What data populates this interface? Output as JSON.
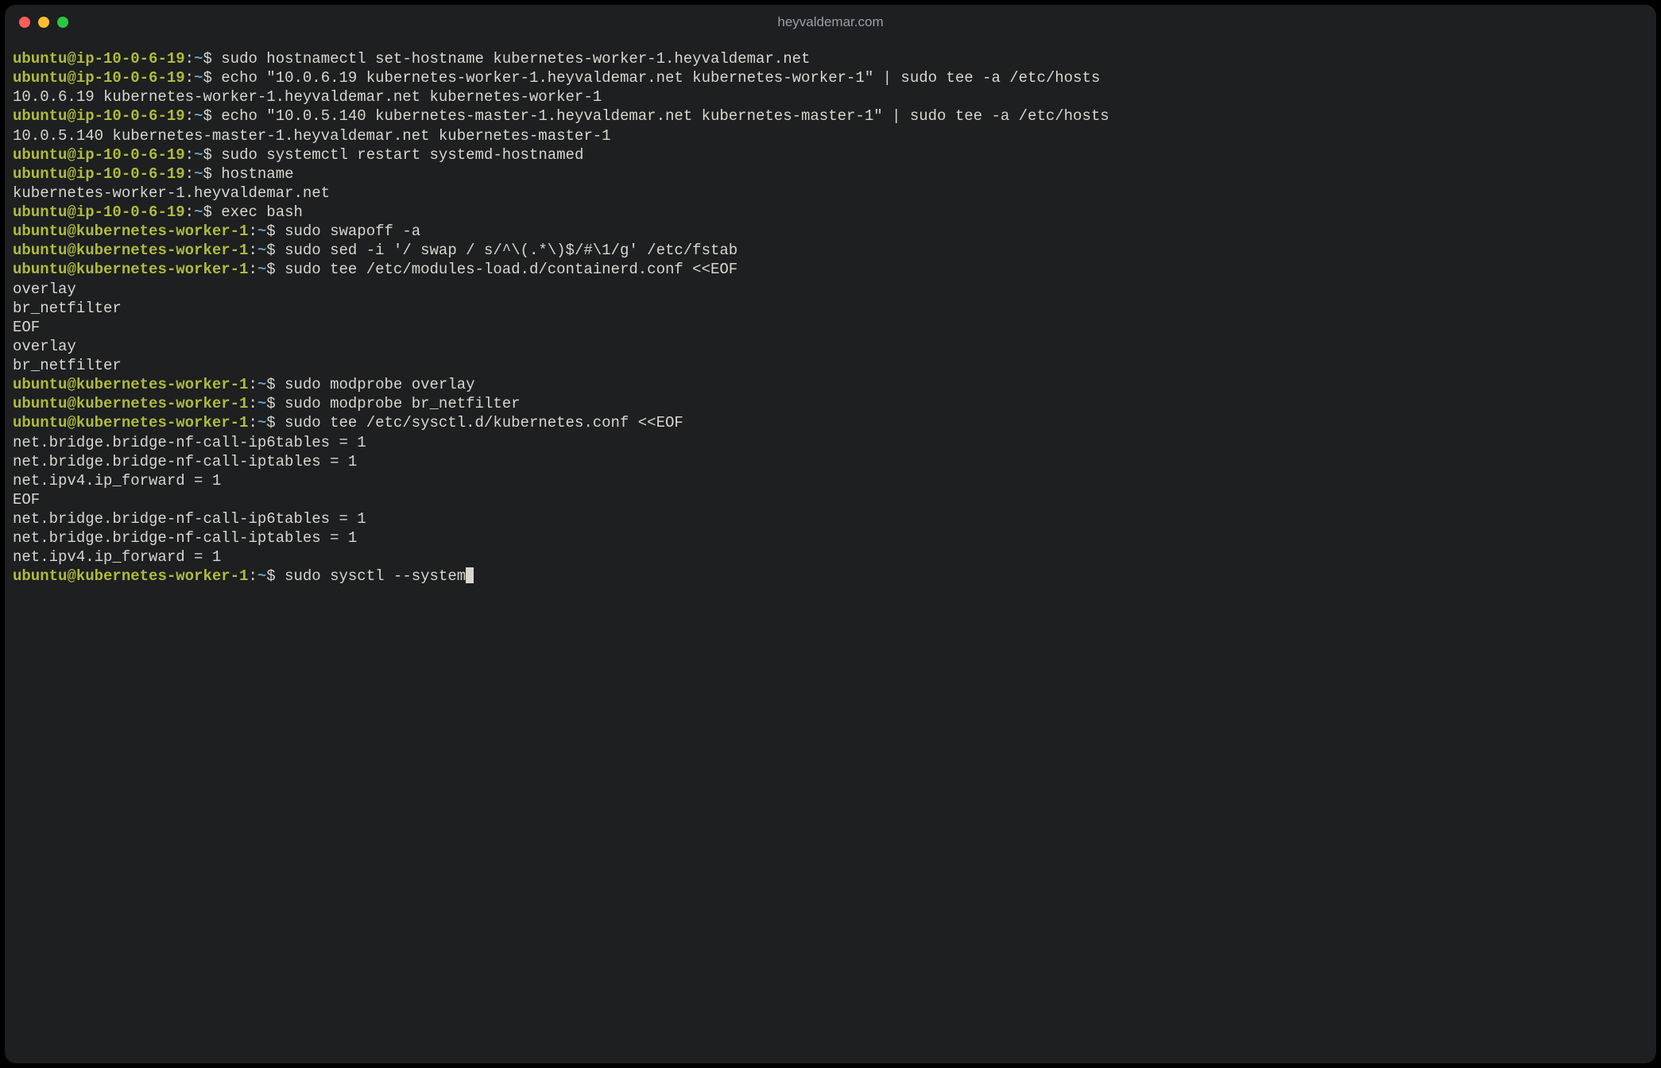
{
  "window": {
    "title": "heyvaldemar.com"
  },
  "colors": {
    "bg": "#1d1f21",
    "fg": "#d9d6cf",
    "userhost": "#b0bb3a",
    "path": "#6c99bb",
    "traffic_red": "#ff5f57",
    "traffic_yellow": "#febc2e",
    "traffic_green": "#28c840"
  },
  "prompt1": {
    "user": "ubuntu",
    "host": "ip-10-0-6-19",
    "path": "~",
    "symbol": "$"
  },
  "prompt2": {
    "user": "ubuntu",
    "host": "kubernetes-worker-1",
    "path": "~",
    "symbol": "$"
  },
  "lines": [
    {
      "type": "cmd",
      "prompt": 1,
      "text": "sudo hostnamectl set-hostname kubernetes-worker-1.heyvaldemar.net"
    },
    {
      "type": "cmd",
      "prompt": 1,
      "text": "echo \"10.0.6.19 kubernetes-worker-1.heyvaldemar.net kubernetes-worker-1\" | sudo tee -a /etc/hosts"
    },
    {
      "type": "out",
      "text": "10.0.6.19 kubernetes-worker-1.heyvaldemar.net kubernetes-worker-1"
    },
    {
      "type": "cmd",
      "prompt": 1,
      "text": "echo \"10.0.5.140 kubernetes-master-1.heyvaldemar.net kubernetes-master-1\" | sudo tee -a /etc/hosts"
    },
    {
      "type": "out",
      "text": "10.0.5.140 kubernetes-master-1.heyvaldemar.net kubernetes-master-1"
    },
    {
      "type": "cmd",
      "prompt": 1,
      "text": "sudo systemctl restart systemd-hostnamed"
    },
    {
      "type": "cmd",
      "prompt": 1,
      "text": "hostname"
    },
    {
      "type": "out",
      "text": "kubernetes-worker-1.heyvaldemar.net"
    },
    {
      "type": "cmd",
      "prompt": 1,
      "text": "exec bash"
    },
    {
      "type": "cmd",
      "prompt": 2,
      "text": "sudo swapoff -a"
    },
    {
      "type": "cmd",
      "prompt": 2,
      "text": "sudo sed -i '/ swap / s/^\\(.*\\)$/#\\1/g' /etc/fstab"
    },
    {
      "type": "cmd",
      "prompt": 2,
      "text": "sudo tee /etc/modules-load.d/containerd.conf <<EOF"
    },
    {
      "type": "out",
      "text": "overlay"
    },
    {
      "type": "out",
      "text": "br_netfilter"
    },
    {
      "type": "out",
      "text": "EOF"
    },
    {
      "type": "out",
      "text": "overlay"
    },
    {
      "type": "out",
      "text": "br_netfilter"
    },
    {
      "type": "cmd",
      "prompt": 2,
      "text": "sudo modprobe overlay"
    },
    {
      "type": "cmd",
      "prompt": 2,
      "text": "sudo modprobe br_netfilter"
    },
    {
      "type": "cmd",
      "prompt": 2,
      "text": "sudo tee /etc/sysctl.d/kubernetes.conf <<EOF"
    },
    {
      "type": "out",
      "text": "net.bridge.bridge-nf-call-ip6tables = 1"
    },
    {
      "type": "out",
      "text": "net.bridge.bridge-nf-call-iptables = 1"
    },
    {
      "type": "out",
      "text": "net.ipv4.ip_forward = 1"
    },
    {
      "type": "out",
      "text": "EOF"
    },
    {
      "type": "out",
      "text": "net.bridge.bridge-nf-call-ip6tables = 1"
    },
    {
      "type": "out",
      "text": "net.bridge.bridge-nf-call-iptables = 1"
    },
    {
      "type": "out",
      "text": "net.ipv4.ip_forward = 1"
    },
    {
      "type": "cmd",
      "prompt": 2,
      "text": "sudo sysctl --system",
      "cursor": true
    }
  ]
}
